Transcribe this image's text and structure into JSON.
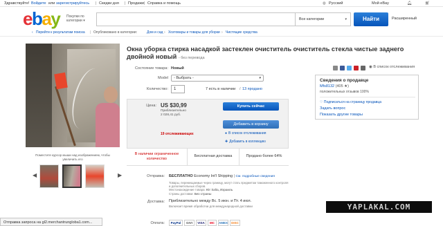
{
  "topbar": {
    "greeting": "Здравствуйте!",
    "signin": "Войдите",
    "or": "или",
    "register": "зарегистрируйтесь",
    "deals": "Скидки дня",
    "sell": "Продажи",
    "help": "Справка и помощь",
    "language": "Русский",
    "my_ebay": "Мой eBay"
  },
  "header": {
    "logo": {
      "e": "e",
      "b": "b",
      "a": "a",
      "y": "y"
    },
    "shop_by": "Покупки по категории",
    "search_value": "",
    "category": "Все категории",
    "find_button": "Найти",
    "advanced": "Расширенный"
  },
  "breadcrumb": {
    "back": "Перейти к результатам поиска",
    "published": "Опубликовано в категории:",
    "c1": "Дом и сад",
    "c2": "Хозтовары и товары для уборки",
    "c3": "Чистящие средства"
  },
  "listing": {
    "title": "Окна уборка стирка насадкой застеклен очиститель очиститель стекла чистые заднего двойной новый",
    "no_translation": "- без перевода",
    "condition_label": "Состояние товара:",
    "condition_value": "Новый",
    "model_label": "Model",
    "model_value": "- Выбрать -",
    "qty_label": "Количество:",
    "qty_value": "1",
    "available": "7 есть в наличии",
    "sold": "13 продано",
    "price_label": "Цена:",
    "price": "US $30,99",
    "approx_label": "Приблизительно",
    "approx_value": "2 028,41 руб.",
    "buy_now": "Купить сейчас",
    "add_to_cart": "Добавить в корзину",
    "watchers": "19 отслеживающих",
    "add_watchlist": "В список отслеживания",
    "add_collection": "Добавить в коллекцию",
    "limited": "В наличии ограниченное количество",
    "free_shipping": "Бесплатная доставка",
    "sold_pct": "Продано более 64%"
  },
  "photo": {
    "caption": "Поместите курсор мыши над изображением, чтобы увеличить его"
  },
  "shipping": {
    "label": "Отправка:",
    "free": "БЕСПЛАТНО",
    "method": "Economy Int'l Shipping",
    "details_link": "См. подробные сведения",
    "note": "Товары, перемещаемые через границу, могут стать предметом таможенного контроля и дополнительных сборов.",
    "location_label": "Местонахождение товара:",
    "location_value": "Юг Salta, Израиль",
    "ships_label": "Страны доставки:",
    "ships_value": "Без страны"
  },
  "delivery": {
    "label": "Доставка:",
    "value": "Приблизительно между Вс. 5 июн. и Пт. 4 июл.",
    "note": "Включает время обработки для международной доставки"
  },
  "payments": {
    "label": "Оплата:",
    "methods": [
      "PayPal",
      "GIVI",
      "VISA",
      "MC",
      "AMEX",
      "DISC"
    ]
  },
  "share": {
    "watch": "В список отслеживания"
  },
  "seller": {
    "header": "Сведения о продавце",
    "name": "Mfs8132",
    "score": "(405 ★)",
    "feedback": "положительных отзывов 100%",
    "subscribe": "Подписаться на страницу продавца",
    "ask": "Задать вопрос",
    "other_items": "Показать другие товары"
  },
  "watermark": "YAPLAKAL.COM",
  "statusbar": "Отправка запроса на gl2.merchantrungloba1.com..."
}
